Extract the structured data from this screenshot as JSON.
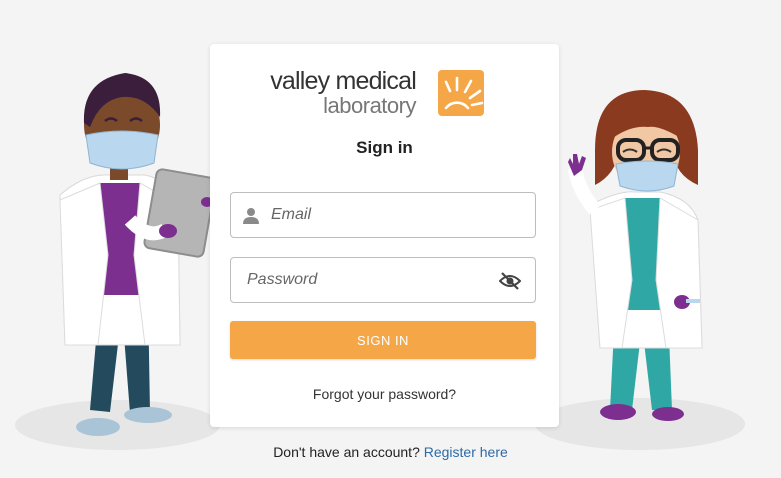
{
  "brand": {
    "line1": "valley medical",
    "line2": "laboratory",
    "accent_color": "#f5a646"
  },
  "form": {
    "title": "Sign in",
    "email_placeholder": "Email",
    "password_placeholder": "Password",
    "email_icon": "person-icon",
    "password_toggle_icon": "eye-off-icon",
    "submit_label": "SIGN IN",
    "forgot_label": "Forgot your password?"
  },
  "footer": {
    "prompt": "Don't have an account?",
    "register_label": "Register here",
    "link_color": "#2d6aa6"
  }
}
